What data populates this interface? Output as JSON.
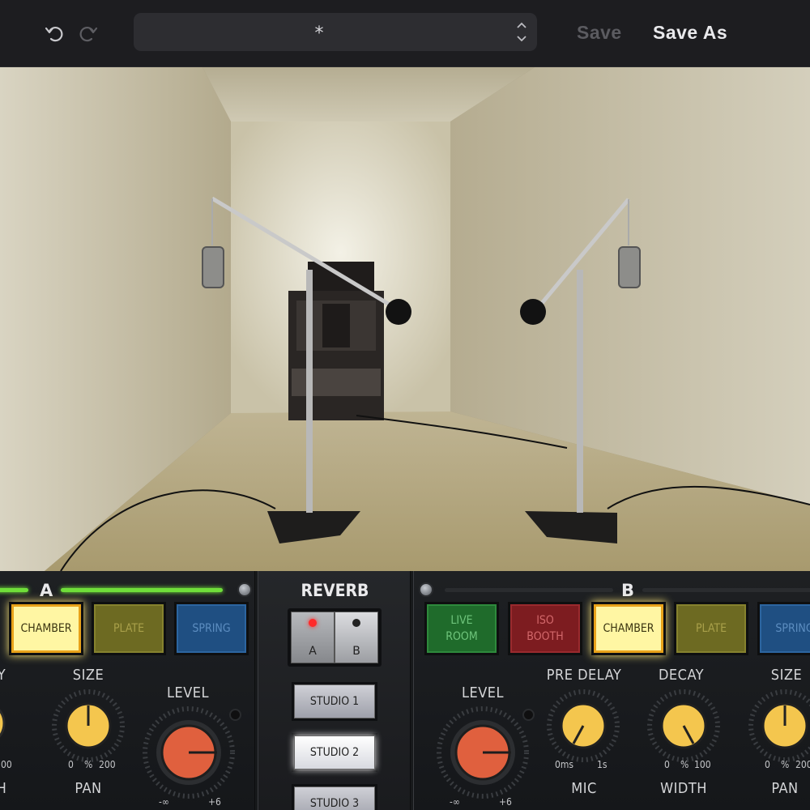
{
  "toolbar": {
    "undo_icon": "undo-icon",
    "redo_icon": "redo-icon",
    "preset_name": "*",
    "save_label": "Save",
    "save_as_label": "Save As"
  },
  "channel_a": {
    "label": "A",
    "buttons": [
      {
        "label_lines": [
          "CHAMBER"
        ],
        "style": "chamber",
        "selected": true
      },
      {
        "label_lines": [
          "PLATE"
        ],
        "style": "plate",
        "selected": false
      },
      {
        "label_lines": [
          "SPRING"
        ],
        "style": "spring",
        "selected": false
      }
    ],
    "knobs": {
      "y_label": "Y",
      "size_label": "SIZE",
      "size_min": "0",
      "size_unit": "%",
      "size_max": "200",
      "size_left_fragment": "00",
      "level_label": "LEVEL",
      "level_min": "-∞",
      "level_max": "+6",
      "h_label": "H",
      "pan_label": "PAN"
    }
  },
  "reverb": {
    "title": "REVERB",
    "ab": {
      "a_label": "A",
      "b_label": "B",
      "active": "A"
    },
    "studios": [
      {
        "label": "STUDIO 1",
        "selected": false
      },
      {
        "label": "STUDIO 2",
        "selected": true
      },
      {
        "label": "STUDIO 3",
        "selected": false
      }
    ]
  },
  "channel_b": {
    "label": "B",
    "buttons": [
      {
        "label_lines": [
          "LIVE",
          "ROOM"
        ],
        "style": "live",
        "selected": false
      },
      {
        "label_lines": [
          "ISO",
          "BOOTH"
        ],
        "style": "iso",
        "selected": false
      },
      {
        "label_lines": [
          "CHAMBER"
        ],
        "style": "chamber",
        "selected": true
      },
      {
        "label_lines": [
          "PLATE"
        ],
        "style": "plate",
        "selected": false
      },
      {
        "label_lines": [
          "SPRING"
        ],
        "style": "spring",
        "selected": false
      }
    ],
    "knobs": {
      "level_label": "LEVEL",
      "level_min": "-∞",
      "level_max": "+6",
      "predelay_label": "PRE DELAY",
      "predelay_min": "0ms",
      "predelay_max": "1s",
      "decay_label": "DECAY",
      "decay_min": "0",
      "decay_unit": "%",
      "decay_max": "100",
      "size_label": "SIZE",
      "size_min": "0",
      "size_unit": "%",
      "size_max": "200",
      "mic_label": "MIC",
      "width_label": "WIDTH",
      "pan_label": "PAN"
    }
  },
  "colors": {
    "accent_green": "#6fde3a",
    "knob_yellow": "#f4c64e",
    "knob_red": "#e0603e",
    "chamber_glow": "#fff6a3"
  }
}
